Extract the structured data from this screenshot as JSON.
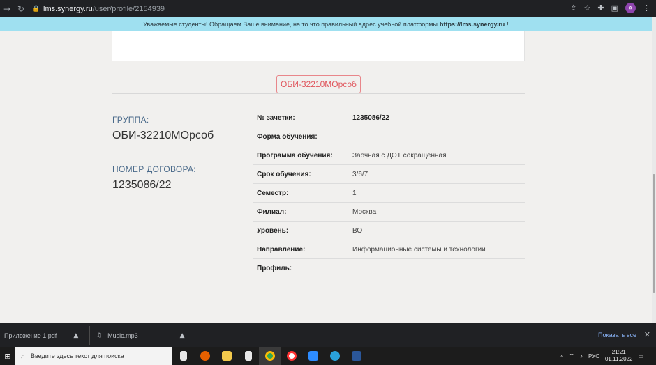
{
  "browser": {
    "url_host": "lms.synergy.ru",
    "url_path": "/user/profile/2154939",
    "avatar_letter": "A"
  },
  "banner": {
    "text": "Уважаемые студенты! Обращаем Ваше внимание, на то что правильный адрес учебной платформы",
    "link": "https://lms.synergy.ru",
    "suffix": "!"
  },
  "profile": {
    "group_badge": "ОБИ-32210МОрсоб",
    "group_label": "ГРУППА:",
    "group_value": "ОБИ-32210МОрсоб",
    "contract_label": "НОМЕР ДОГОВОРА:",
    "contract_value": "1235086/22",
    "rows": [
      {
        "key": "№ зачетки:",
        "value": "1235086/22"
      },
      {
        "key": "Форма обучения:",
        "value": ""
      },
      {
        "key": "Программа обучения:",
        "value": "Заочная с ДОТ сокращенная"
      },
      {
        "key": "Срок обучения:",
        "value": "3/6/7"
      },
      {
        "key": "Семестр:",
        "value": "1"
      },
      {
        "key": "Филиал:",
        "value": "Москва"
      },
      {
        "key": "Уровень:",
        "value": "ВО"
      },
      {
        "key": "Направление:",
        "value": "Информационные системы и технологии"
      },
      {
        "key": "Профиль:",
        "value": ""
      }
    ]
  },
  "downloads": {
    "items": [
      "Приложение 1.pdf",
      "Music.mp3"
    ],
    "show_all": "Показать все"
  },
  "taskbar": {
    "search_placeholder": "Введите здесь текст для поиска",
    "lang": "РУС",
    "time": "21:21",
    "date": "01.11.2022"
  },
  "colors": {
    "accent_red": "#e0555c",
    "banner_bg": "#9fe0f0",
    "label_blue": "#4a6a8a"
  }
}
